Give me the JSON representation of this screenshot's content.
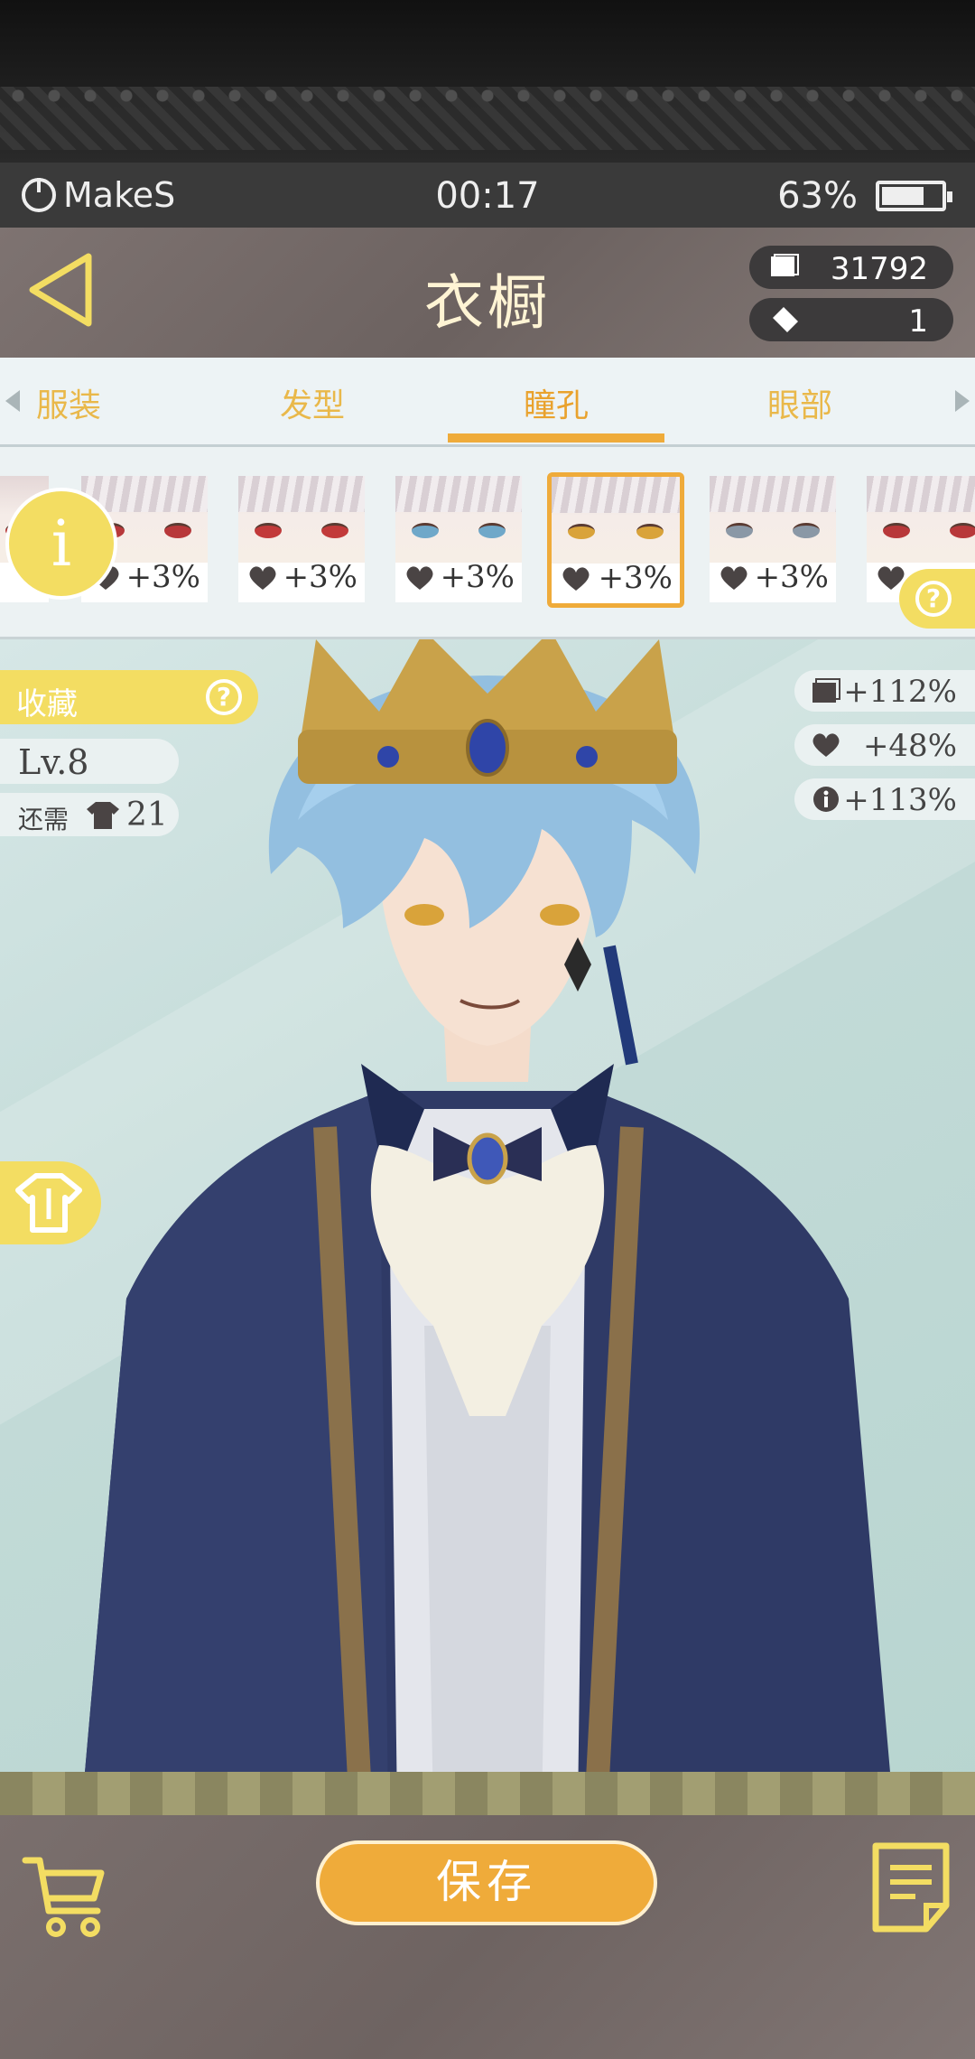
{
  "status_bar": {
    "app_name": "MakeS",
    "time": "00:17",
    "battery": "63%"
  },
  "header": {
    "title": "衣橱",
    "coins": "31792",
    "tickets": "1"
  },
  "tabs": [
    {
      "label": "服装",
      "active": false
    },
    {
      "label": "发型",
      "active": false
    },
    {
      "label": "瞳孔",
      "active": true
    },
    {
      "label": "眼部",
      "active": false
    }
  ],
  "items": [
    {
      "bonus": "+3%",
      "eye_color": "#b8383a"
    },
    {
      "bonus": "+3%",
      "eye_color": "#c23a3a"
    },
    {
      "bonus": "+3%",
      "eye_color": "#6fa8c9"
    },
    {
      "bonus": "+3%",
      "eye_color": "#d9a33a",
      "selected": true
    },
    {
      "bonus": "+3%",
      "eye_color": "#8a98a6"
    },
    {
      "bonus": "",
      "eye_color": "#b8383a"
    }
  ],
  "info_badge": "i",
  "collection": {
    "label": "收藏",
    "level": "Lv.8",
    "need_label": "还需",
    "need_count": "21"
  },
  "stats": {
    "coin_bonus": "+112%",
    "heart_bonus": "+48%",
    "info_bonus": "+113%"
  },
  "bottom": {
    "save_label": "保存"
  },
  "colors": {
    "accent_yellow": "#f3dd62",
    "accent_orange": "#efab3a",
    "tab_text": "#e9b84a"
  }
}
